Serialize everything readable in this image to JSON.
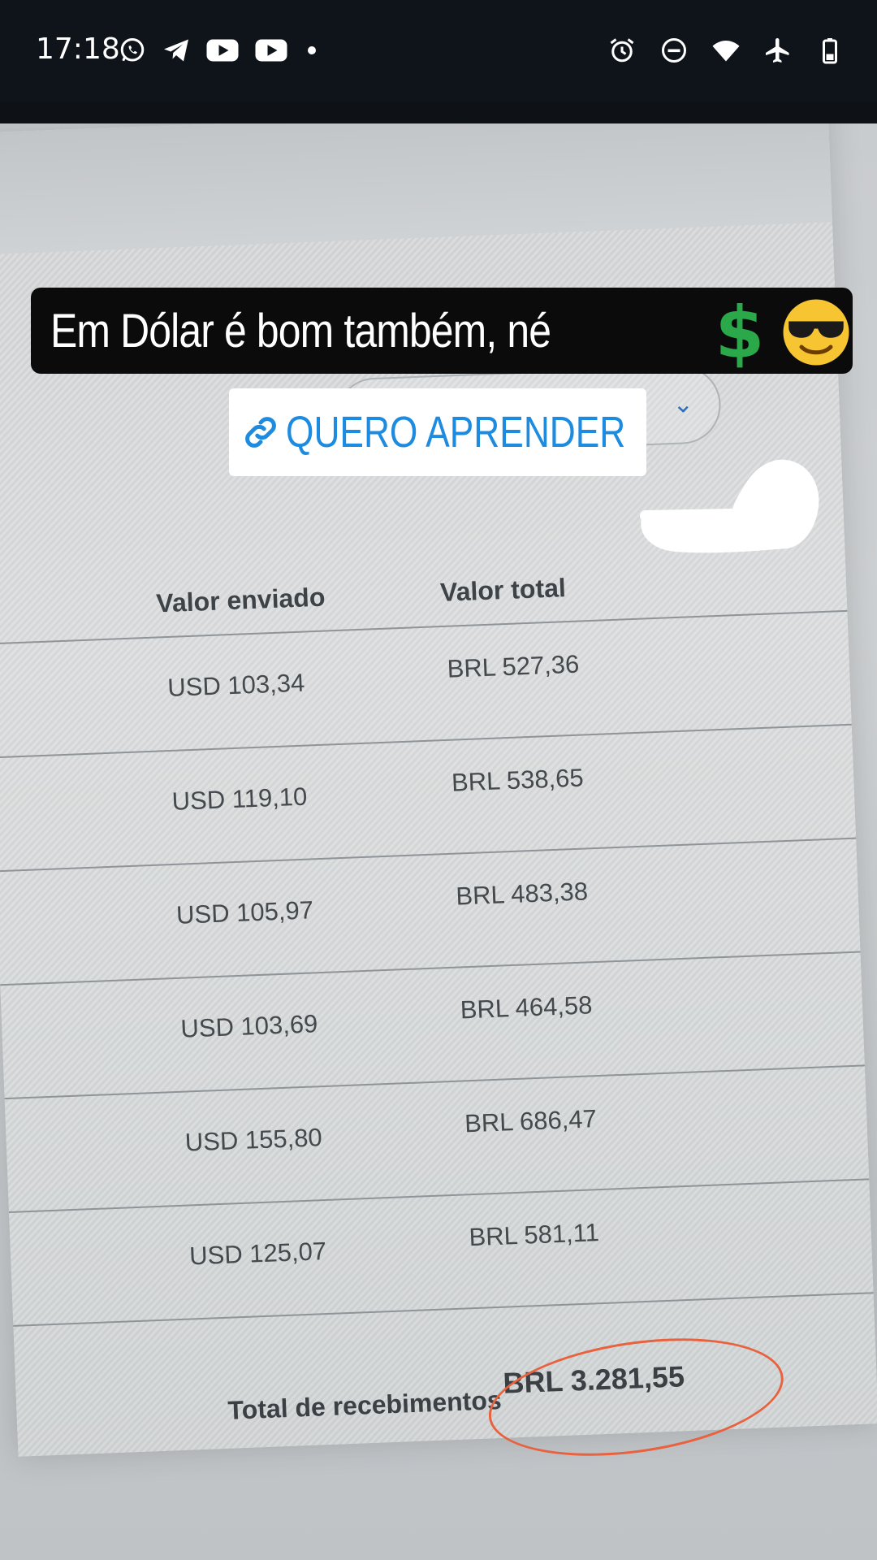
{
  "status_bar": {
    "time": "17:18",
    "left_icons": [
      "whatsapp-icon",
      "telegram-icon",
      "youtube-icon",
      "youtube-icon",
      "notification-dot"
    ],
    "right_icons": [
      "alarm-icon",
      "do-not-disturb-icon",
      "wifi-icon",
      "airplane-mode-icon",
      "battery-icon"
    ]
  },
  "caption": {
    "text": "Em Dólar é bom também, né",
    "emojis": [
      "heavy-dollar-sign",
      "smiling-face-with-sunglasses"
    ]
  },
  "link_sticker": {
    "label": "QUERO APRENDER",
    "icon": "link-icon",
    "color": "#1d8ce0"
  },
  "table": {
    "headers": {
      "sent": "Valor enviado",
      "total": "Valor total"
    },
    "rows": [
      {
        "sent": "USD 103,34",
        "total": "BRL 527,36"
      },
      {
        "sent": "USD 119,10",
        "total": "BRL 538,65"
      },
      {
        "sent": "USD 105,97",
        "total": "BRL 483,38"
      },
      {
        "sent": "USD 103,69",
        "total": "BRL 464,58"
      },
      {
        "sent": "USD 155,80",
        "total": "BRL 686,47"
      },
      {
        "sent": "USD 125,07",
        "total": "BRL 581,11"
      }
    ],
    "total": {
      "label": "Total de recebimentos",
      "value": "BRL 3.281,55",
      "highlight_color": "#e8623f"
    }
  }
}
